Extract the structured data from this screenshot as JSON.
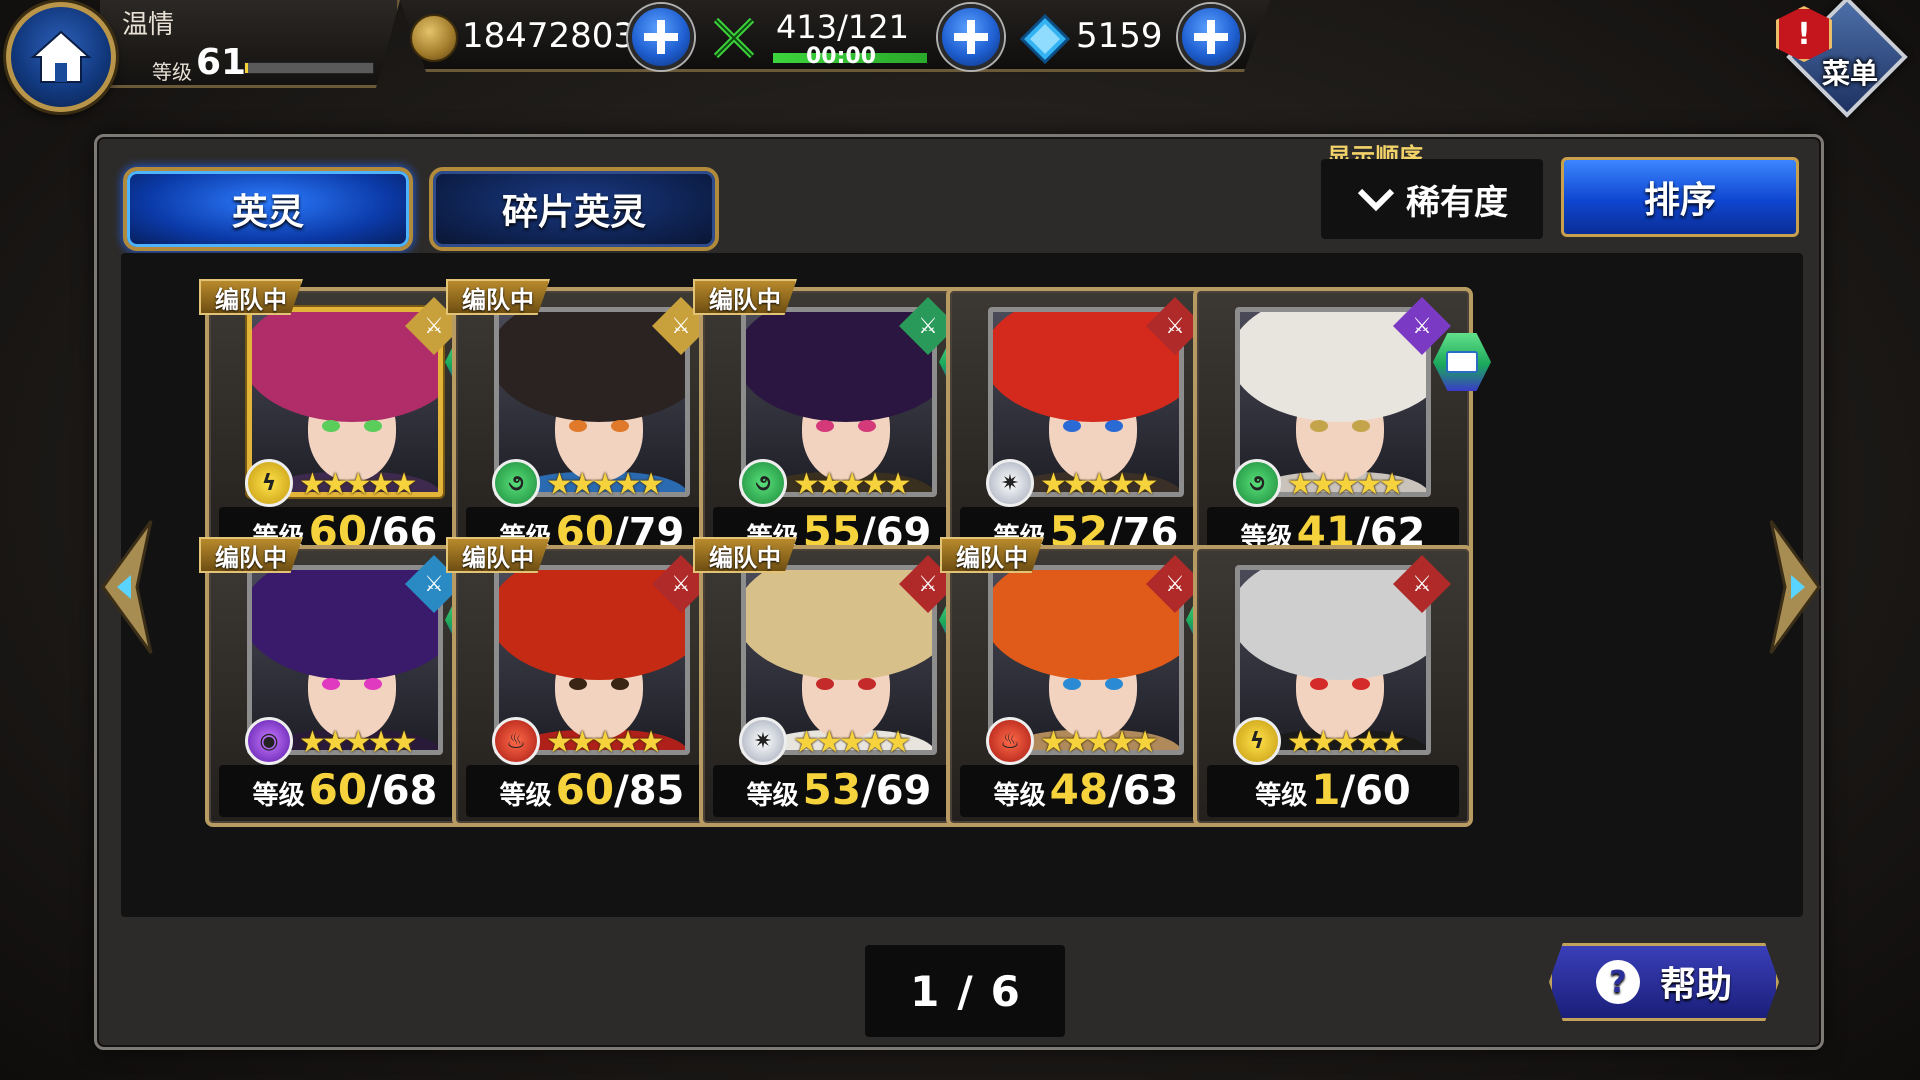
{
  "header": {
    "player_name": "温情",
    "level_label": "等级",
    "level": "61",
    "exp_fraction": 0.02,
    "gold": "18472803",
    "stamina": "413/121",
    "stamina_timer": "00:00",
    "stamina_fraction": 1.0,
    "gems": "5159",
    "menu_label": "菜单",
    "alert_badge": "!"
  },
  "tabs": [
    {
      "label": "英灵",
      "active": true
    },
    {
      "label": "碎片英灵",
      "active": false
    }
  ],
  "sort": {
    "order_label": "显示顺序",
    "order_value": "稀有度",
    "sort_button": "排序"
  },
  "team_tag": "编队中",
  "level_label": "等级",
  "cards": [
    {
      "level": "60",
      "max": "66",
      "in_team": true,
      "element": "thunder",
      "class_color": "#c9a13c",
      "rarity": 5,
      "book": true,
      "gold_frame": true,
      "hair": "#b02d6a",
      "eye": "#5acd5a",
      "body": "#3d2a4e"
    },
    {
      "level": "60",
      "max": "79",
      "in_team": true,
      "element": "wind",
      "class_color": "#c9a13c",
      "rarity": 5,
      "book": false,
      "gold_frame": false,
      "hair": "#2b2322",
      "eye": "#e07a2a",
      "body": "#2a6ab0"
    },
    {
      "level": "55",
      "max": "69",
      "in_team": true,
      "element": "wind",
      "class_color": "#2a9a5a",
      "rarity": 5,
      "book": true,
      "gold_frame": false,
      "hair": "#2a1640",
      "eye": "#d43a7a",
      "body": "#3a3020"
    },
    {
      "level": "52",
      "max": "76",
      "in_team": false,
      "element": "light",
      "class_color": "#b02a2a",
      "rarity": 5,
      "book": false,
      "gold_frame": false,
      "hair": "#d42a1e",
      "eye": "#2a6ad4",
      "body": "#3a3028"
    },
    {
      "level": "41",
      "max": "62",
      "in_team": false,
      "element": "wind",
      "class_color": "#7a3ac4",
      "rarity": 5,
      "book": true,
      "gold_frame": false,
      "hair": "#e8e4de",
      "eye": "#c4a44a",
      "body": "#c9c3bb"
    },
    {
      "level": "60",
      "max": "68",
      "in_team": true,
      "element": "dark",
      "class_color": "#2a8ac4",
      "rarity": 5,
      "book": true,
      "gold_frame": false,
      "hair": "#3a1a6a",
      "eye": "#e03ac0",
      "body": "#2a1a3a"
    },
    {
      "level": "60",
      "max": "85",
      "in_team": true,
      "element": "fire",
      "class_color": "#b02a2a",
      "rarity": 5,
      "book": false,
      "gold_frame": false,
      "hair": "#c42a14",
      "eye": "#3a2414",
      "body": "#b0201a"
    },
    {
      "level": "53",
      "max": "69",
      "in_team": true,
      "element": "light",
      "class_color": "#b02a2a",
      "rarity": 5,
      "book": true,
      "gold_frame": false,
      "hair": "#d8c08a",
      "eye": "#c42a2a",
      "body": "#e8e4de"
    },
    {
      "level": "48",
      "max": "63",
      "in_team": true,
      "element": "fire",
      "class_color": "#b02a2a",
      "rarity": 5,
      "book": true,
      "gold_frame": false,
      "hair": "#e05a1a",
      "eye": "#2a8ad4",
      "body": "#b08a5a"
    },
    {
      "level": "1",
      "max": "60",
      "in_team": false,
      "element": "thunder",
      "class_color": "#b02a2a",
      "rarity": 5,
      "book": false,
      "gold_frame": false,
      "hair": "#cfcfcf",
      "eye": "#d42a2a",
      "body": "#1a1a1a"
    }
  ],
  "pager": {
    "current": "1",
    "separator": "/",
    "total": "6"
  },
  "help_label": "帮助",
  "colors": {
    "accent_blue": "#1f5fd1",
    "gold_text": "#f6d33c",
    "frame_gold": "#b89b62"
  }
}
